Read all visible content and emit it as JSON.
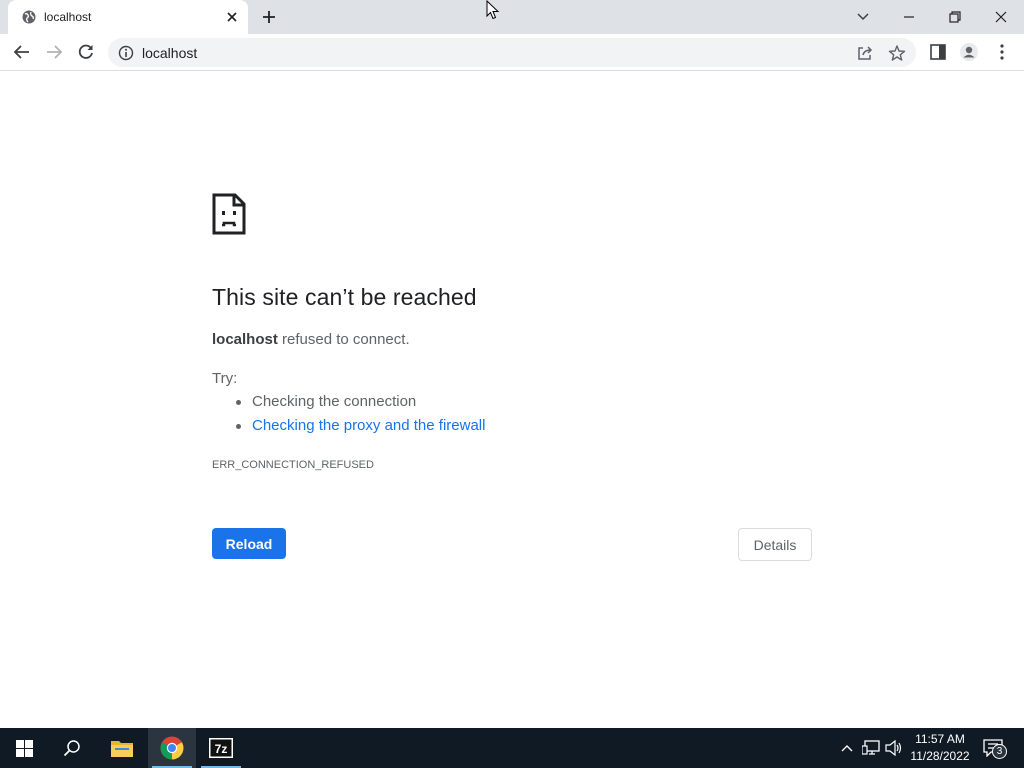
{
  "browser": {
    "tab": {
      "title": "localhost"
    },
    "address_bar": {
      "url": "localhost"
    }
  },
  "error_page": {
    "heading": "This site can’t be reached",
    "host": "localhost",
    "summary_rest": " refused to connect.",
    "try_label": "Try:",
    "suggestions": [
      "Checking the connection",
      "Checking the proxy and the firewall"
    ],
    "error_code": "ERR_CONNECTION_REFUSED",
    "reload_label": "Reload",
    "details_label": "Details"
  },
  "taskbar": {
    "time": "11:57 AM",
    "date": "11/28/2022",
    "notification_count": "3",
    "apps": [
      "windows-start-icon",
      "search-icon",
      "file-explorer-icon",
      "chrome-icon",
      "7zip-icon"
    ]
  },
  "colors": {
    "accent": "#1a73e8",
    "tabstrip": "#dee1e6",
    "taskbar": "#101a24"
  }
}
